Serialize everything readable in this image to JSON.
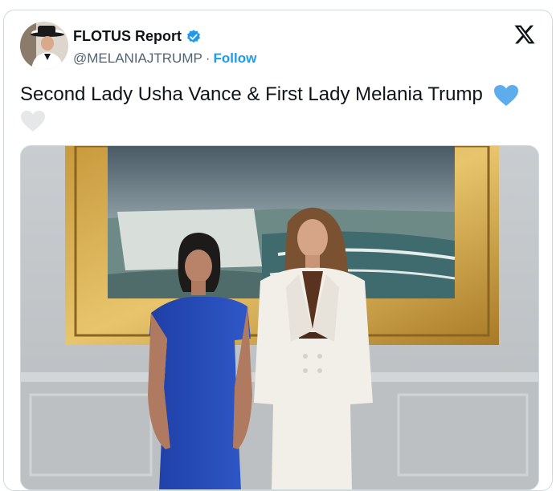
{
  "account": {
    "display_name": "FLOTUS Report",
    "handle": "@MELANIAJTRUMP",
    "separator": "·",
    "follow_label": "Follow",
    "verified_color": "#1d9bf0"
  },
  "tweet": {
    "text": "Second Lady Usha Vance & First Lady Melania Trump",
    "emojis": [
      "blue-heart",
      "white-heart"
    ]
  },
  "colors": {
    "accent": "#1d9bf0",
    "muted_text": "#536471",
    "border": "#cfd9de"
  },
  "icons": {
    "brand": "x-logo",
    "badge": "verified-badge"
  }
}
